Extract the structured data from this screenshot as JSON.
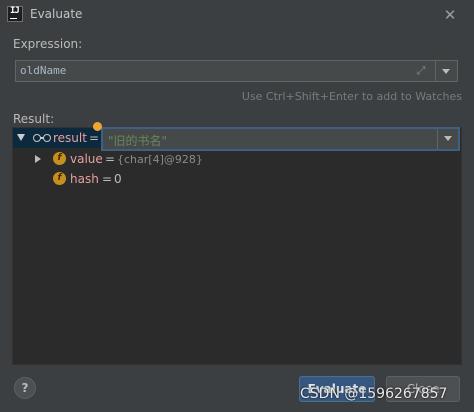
{
  "window": {
    "title": "Evaluate",
    "close_glyph": "✕"
  },
  "expression": {
    "label": "Expression:",
    "value": "oldName",
    "hint": "Use Ctrl+Shift+Enter to add to Watches"
  },
  "result": {
    "label": "Result:",
    "root": {
      "name": "result",
      "eq": "=",
      "value": "\"旧的书名\""
    },
    "children": [
      {
        "icon": "f",
        "name": "value",
        "eq": "=",
        "value": "{char[4]@928}"
      },
      {
        "icon": "f",
        "name": "hash",
        "eq": "=",
        "value": "0"
      }
    ]
  },
  "buttons": {
    "help": "?",
    "evaluate": "Evaluate",
    "close": "Close"
  },
  "watermark": "CSDN @1596267857",
  "icons": {
    "app": "intellij-idea-icon",
    "expand": "expand-editor-icon",
    "watch": "glasses-watch-icon",
    "field": "field-icon",
    "bulb": "lightbulb-icon"
  },
  "colors": {
    "background": "#3c3f41",
    "panel": "#2b2b2b",
    "selection": "#0d293e",
    "accent_button": "#365880",
    "string_value": "#6a8759",
    "variable_name": "#e5a0a0",
    "field_icon": "#c7901e"
  }
}
